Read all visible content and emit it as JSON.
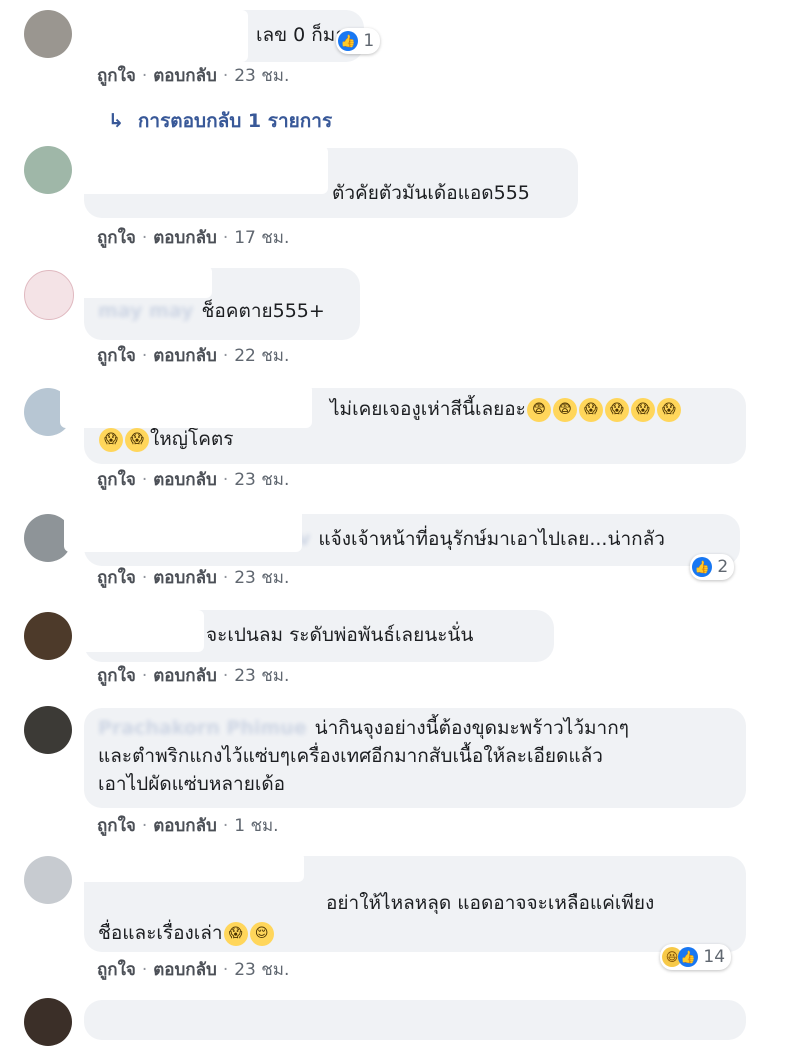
{
  "actions": {
    "like": "ถูกใจ",
    "reply": "ตอบกลับ",
    "separator": "·"
  },
  "reply_link": {
    "arrow": "↳",
    "label": "การตอบกลับ 1 รายการ"
  },
  "comments": [
    {
      "text": "เลข 0 ก็มา",
      "time": "23 ชม.",
      "reactions": "1"
    },
    {
      "text": "ตัวคัยตัวมันเด้อแอด555",
      "time": "17 ชม."
    },
    {
      "name_fragment": "may may",
      "text": "ช็อคตาย555+",
      "time": "22 ชม."
    },
    {
      "line1": "ไม่เคยเจองูเห่าสีนี้เลยอะ",
      "line1_emoji": [
        "😨",
        "😨",
        "😱",
        "😱",
        "😱",
        "😱"
      ],
      "line2_emoji": [
        "😱",
        "😱"
      ],
      "line2": "ใหญ่โคตร",
      "time": "23 ชม."
    },
    {
      "name_fragment": "v",
      "text": "แจ้งเจ้าหน้าที่อนุรักษ์มาเอาไปเลย...น่ากลัว",
      "time": "23 ชม.",
      "reactions": "2"
    },
    {
      "text": "จะเปนลม ระดับพ่อพันธ์เลยนะนั่น",
      "time": "23 ชม."
    },
    {
      "name_fragment": "Prachakorn Phimue",
      "line1": "น่ากินจุงอย่างนี้ต้องขุดมะพร้าวไว้มากๆ",
      "line2": "และตำพริกแกงไว้แซ่บๆเครื่องเทศอีกมากสับเนื้อให้ละเอียดแล้ว",
      "line3": "เอาไปผัดแซ่บหลายเด้อ",
      "time": "1 ชม."
    },
    {
      "line1": "อย่าให้ไหลหลุด แอดอาจจะเหลือแค่เพียง",
      "line2": "ชื่อและเรื่องเล่า",
      "line2_emoji": [
        "😱",
        "😌"
      ],
      "time": "23 ชม.",
      "reactions": "14"
    }
  ],
  "colors": {
    "bubble": "#f0f2f5",
    "link": "#385898",
    "like_blue": "#1877f2",
    "meta": "#606770"
  }
}
